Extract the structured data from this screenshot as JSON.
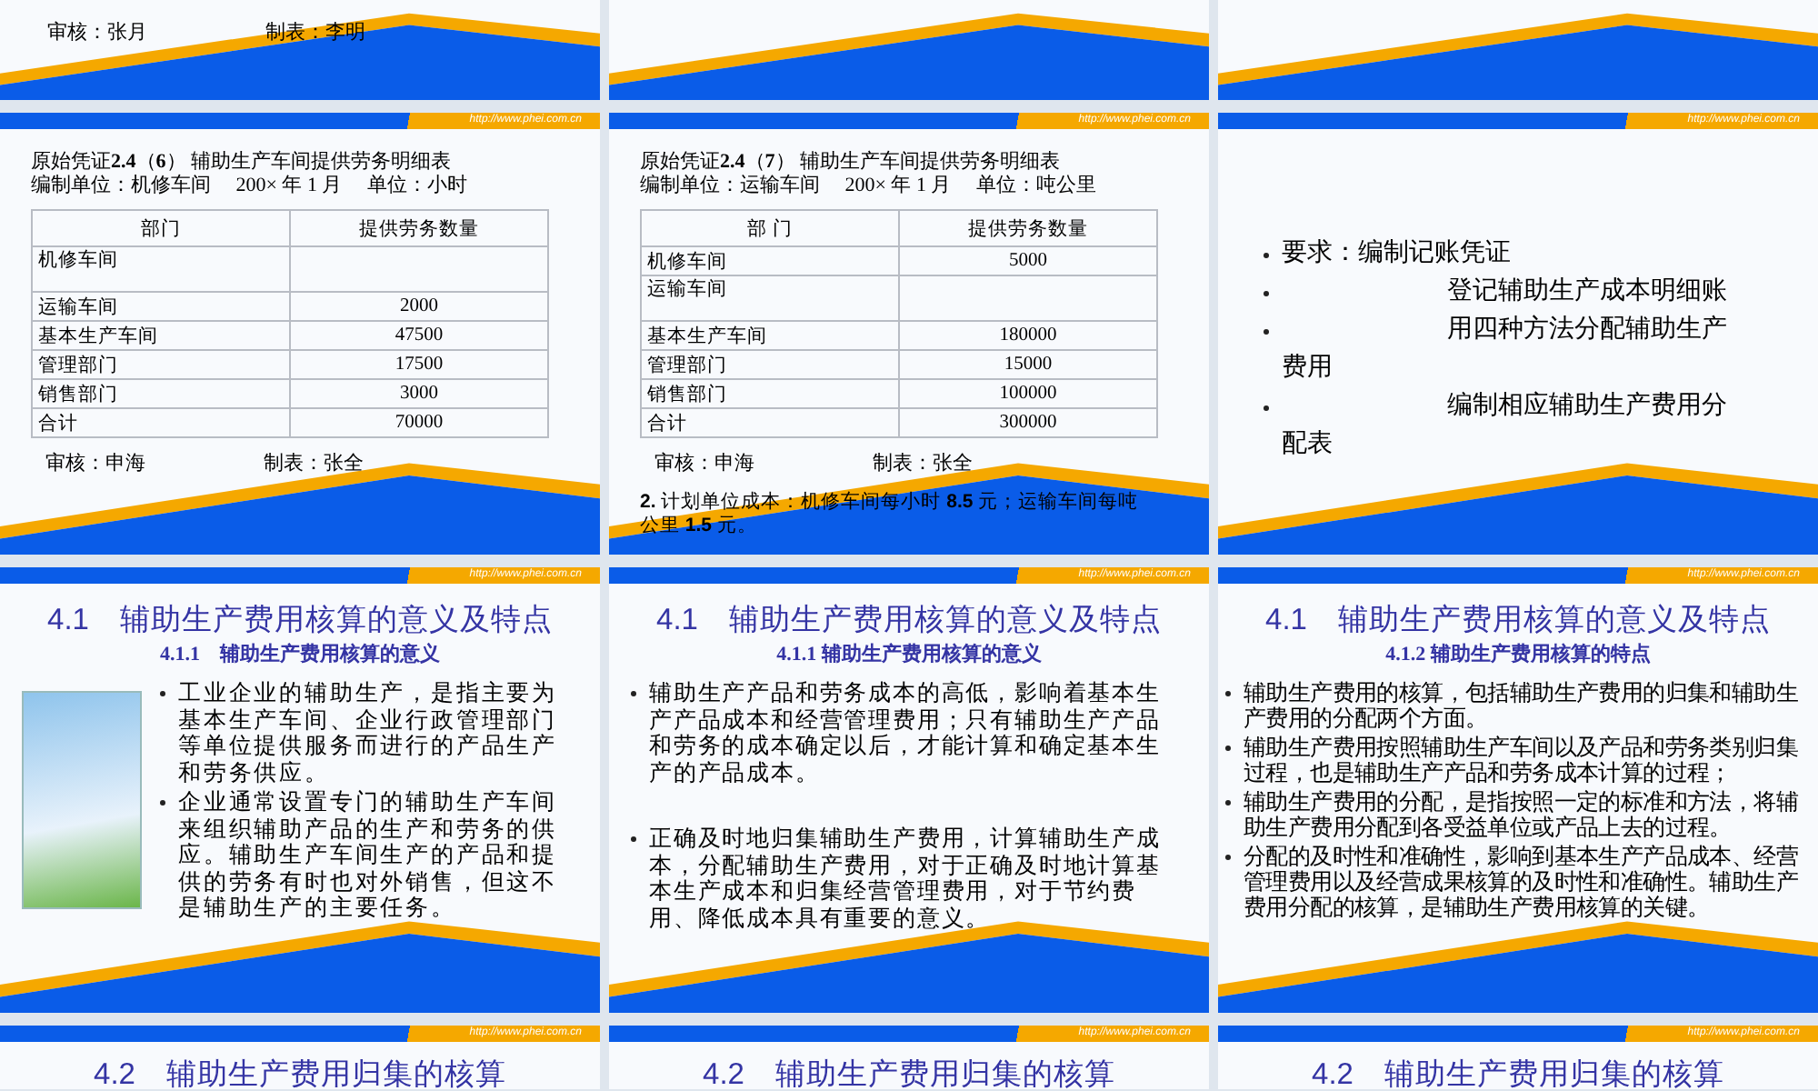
{
  "slides": [
    {
      "kind": "tail",
      "signatures": [
        "审核：张月",
        "制表：李明"
      ]
    },
    {
      "kind": "tail"
    },
    {
      "kind": "tail"
    },
    {
      "kind": "table",
      "url": "http://www.phei.com.cn",
      "title": "原始凭证**2.4**（**6**） 辅助生产车间提供劳务明细表",
      "meta": "编制单位：机修车间　 200× 年 1 月　 单位：小时",
      "columns": [
        "部门",
        "提供劳务数量"
      ],
      "rows": [
        {
          "dept": "机修车间",
          "tall": true
        },
        {
          "dept": "运输车间",
          "amount": "2000"
        },
        {
          "dept": "基本生产车间",
          "amount": "47500"
        },
        {
          "dept": "管理部门",
          "amount": "17500"
        },
        {
          "dept": "销售部门",
          "amount": "3000"
        },
        {
          "dept": "合计",
          "amount": "70000"
        }
      ],
      "signatures": [
        "审核：申海",
        "制表：张全"
      ]
    },
    {
      "kind": "table",
      "url": "http://www.phei.com.cn",
      "title": "原始凭证**2.4**（**7**） 辅助生产车间提供劳务明细表",
      "meta": "编制单位：运输车间　 200× 年 1 月　 单位：吨公里",
      "columns": [
        "部 门",
        "提供劳务数量"
      ],
      "rows": [
        {
          "dept": "机修车间",
          "amount": "5000"
        },
        {
          "dept": "运输车间",
          "tall": true
        },
        {
          "dept": "基本生产车间",
          "amount": "180000"
        },
        {
          "dept": "管理部门",
          "amount": "15000"
        },
        {
          "dept": "销售部门",
          "amount": "100000"
        },
        {
          "dept": "合计",
          "amount": "300000"
        }
      ],
      "signatures": [
        "审核：申海",
        "制表：张全"
      ],
      "note": "**2.** 计划单位成本：机修车间每小时 **8.5** 元；运输车间每吨公里 **1.5** 元。"
    },
    {
      "kind": "list",
      "url": "http://www.phei.com.cn",
      "items": [
        {
          "text": "要求：编制记账凭证",
          "indent": false
        },
        {
          "text": "登记辅助生产成本明细账",
          "indent": true
        },
        {
          "text": "用四种方法分配辅助生产费用",
          "indent": true
        },
        {
          "text": "编制相应辅助生产费用分配表",
          "indent": true
        }
      ]
    },
    {
      "kind": "section",
      "url": "http://www.phei.com.cn",
      "photo": true,
      "title": "4.1　辅助生产费用核算的意义及特点",
      "subtitle": "4.1.1　辅助生产费用核算的意义",
      "bullets": [
        "工业企业的辅助生产，是指主要为基本生产车间、企业行政管理部门等单位提供服务而进行的产品生产和劳务供应。",
        "企业通常设置专门的辅助生产车间来组织辅助产品的生产和劳务的供应。辅助生产车间生产的产品和提供的劳务有时也对外销售，但这不是辅助生产的主要任务。"
      ]
    },
    {
      "kind": "section",
      "url": "http://www.phei.com.cn",
      "photo": false,
      "title": "4.1　辅助生产费用核算的意义及特点",
      "subtitle": "4.1.1 辅助生产费用核算的意义",
      "bullets": [
        "辅助生产产品和劳务成本的高低，影响着基本生产产品成本和经营管理费用；只有辅助生产产品和劳务的成本确定以后，才能计算和确定基本生产的产品成本。",
        "正确及时地归集辅助生产费用，计算辅助生产成本，分配辅助生产费用，对于正确及时地计算基本生产成本和归集经营管理费用，对于节约费用、降低成本具有重要的意义。"
      ]
    },
    {
      "kind": "section",
      "url": "http://www.phei.com.cn",
      "photo": false,
      "title": "4.1　辅助生产费用核算的意义及特点",
      "subtitle": "4.1.2 辅助生产费用核算的特点",
      "bullets": [
        "辅助生产费用的核算，包括辅助生产费用的归集和辅助生产费用的分配两个方面。",
        "辅助生产费用按照辅助生产车间以及产品和劳务类别归集过程，也是辅助生产产品和劳务成本计算的过程；",
        "辅助生产费用的分配，是指按照一定的标准和方法，将辅助生产费用分配到各受益单位或产品上去的过程。",
        "分配的及时性和准确性，影响到基本生产产品成本、经营管理费用以及经营成果核算的及时性和准确性。辅助生产费用分配的核算，是辅助生产费用核算的关键。"
      ]
    },
    {
      "kind": "heading",
      "url": "http://www.phei.com.cn",
      "title": "4.2　辅助生产费用归集的核算"
    },
    {
      "kind": "heading",
      "url": "http://www.phei.com.cn",
      "title": "4.2　辅助生产费用归集的核算"
    },
    {
      "kind": "heading",
      "url": "http://www.phei.com.cn",
      "title": "4.2　辅助生产费用归集的核算"
    }
  ]
}
